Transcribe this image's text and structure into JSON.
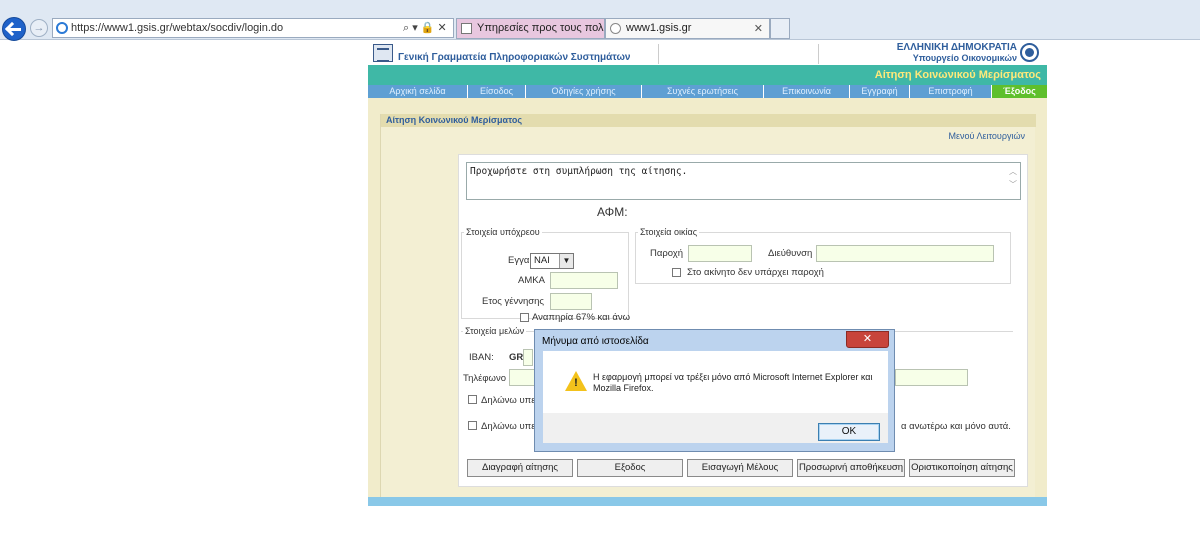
{
  "browser": {
    "url": "https://www1.gsis.gr/webtax/socdiv/login.do",
    "tabs": [
      {
        "label": "Υπηρεσίες προς τους πολίτες"
      },
      {
        "label": "www1.gsis.gr"
      }
    ],
    "address_tools": "⌕ ▾ 🔒 ✕",
    "close_glyph": "✕"
  },
  "header": {
    "org_title": "Γενική Γραμματεία Πληροφοριακών Συστημάτων",
    "gov_title": "ΕΛΛΗΝΙΚΗ ΔΗΜΟΚΡΑΤΙΑ",
    "gov_subtitle": "Υπουργείο Οικονομικών",
    "app_title": "Αίτηση Κοινωνικού Μερίσματος"
  },
  "nav": {
    "items": [
      {
        "label": "Αρχική σελίδα"
      },
      {
        "label": "Είσοδος"
      },
      {
        "label": "Οδηγίες χρήσης"
      },
      {
        "label": "Συχνές ερωτήσεις"
      },
      {
        "label": "Επικοινωνία"
      },
      {
        "label": "Εγγραφή"
      },
      {
        "label": "Επιστροφή"
      },
      {
        "label": "Έξοδος"
      }
    ]
  },
  "panel": {
    "title": "Αίτηση Κοινωνικού Μερίσματος",
    "menu_link": "Μενού Λειτουργιών"
  },
  "form": {
    "message": "Προχωρήστε στη συμπλήρωση της αίτησης.",
    "afm_label": "ΑΦΜ:",
    "debtor_legend": "Στοιχεία υπόχρεου",
    "married_label": "Εγγαμος",
    "married_value": "ΝΑΙ",
    "amka_label": "ΑΜΚΑ",
    "birth_year_label": "Ετος γέννησης",
    "disability_label": "Αναπηρία 67% και άνω",
    "house_legend": "Στοιχεία οικίας",
    "supply_label": "Παροχή",
    "address_label": "Διεύθυνση",
    "no_supply_label": "Στο ακίνητο δεν υπάρχει παροχή",
    "members_legend": "Στοιχεία μελών",
    "iban_label": "IBAN:",
    "iban_prefix": "GR",
    "phone_label": "Τηλέφωνο",
    "declare_1": "Δηλώνω υπεύ",
    "declare_2": "Δηλώνω υπεύ",
    "declare_2_tail": "α ανωτέρω και μόνο αυτά.",
    "buttons": {
      "delete": "Διαγραφή αίτησης",
      "exit": "Εξοδος",
      "add_member": "Εισαγωγή Μέλους",
      "temp_save": "Προσωρινή αποθήκευση",
      "finalize": "Οριστικοποίηση αίτησης"
    }
  },
  "dialog": {
    "title": "Μήνυμα από ιστοσελίδα",
    "message": "Η εφαρμογή μπορεί να τρέξει μόνο από Microsoft Internet Explorer και Mozilla Firefox.",
    "ok_label": "OK",
    "close_glyph": "✕",
    "warning_glyph": "!"
  },
  "colors": {
    "teal": "#3fb8a6",
    "nav_blue": "#5e9fd3",
    "logout_green": "#5fbf2c",
    "page_bg": "#f1eccb",
    "app_title": "#ffe97a"
  }
}
